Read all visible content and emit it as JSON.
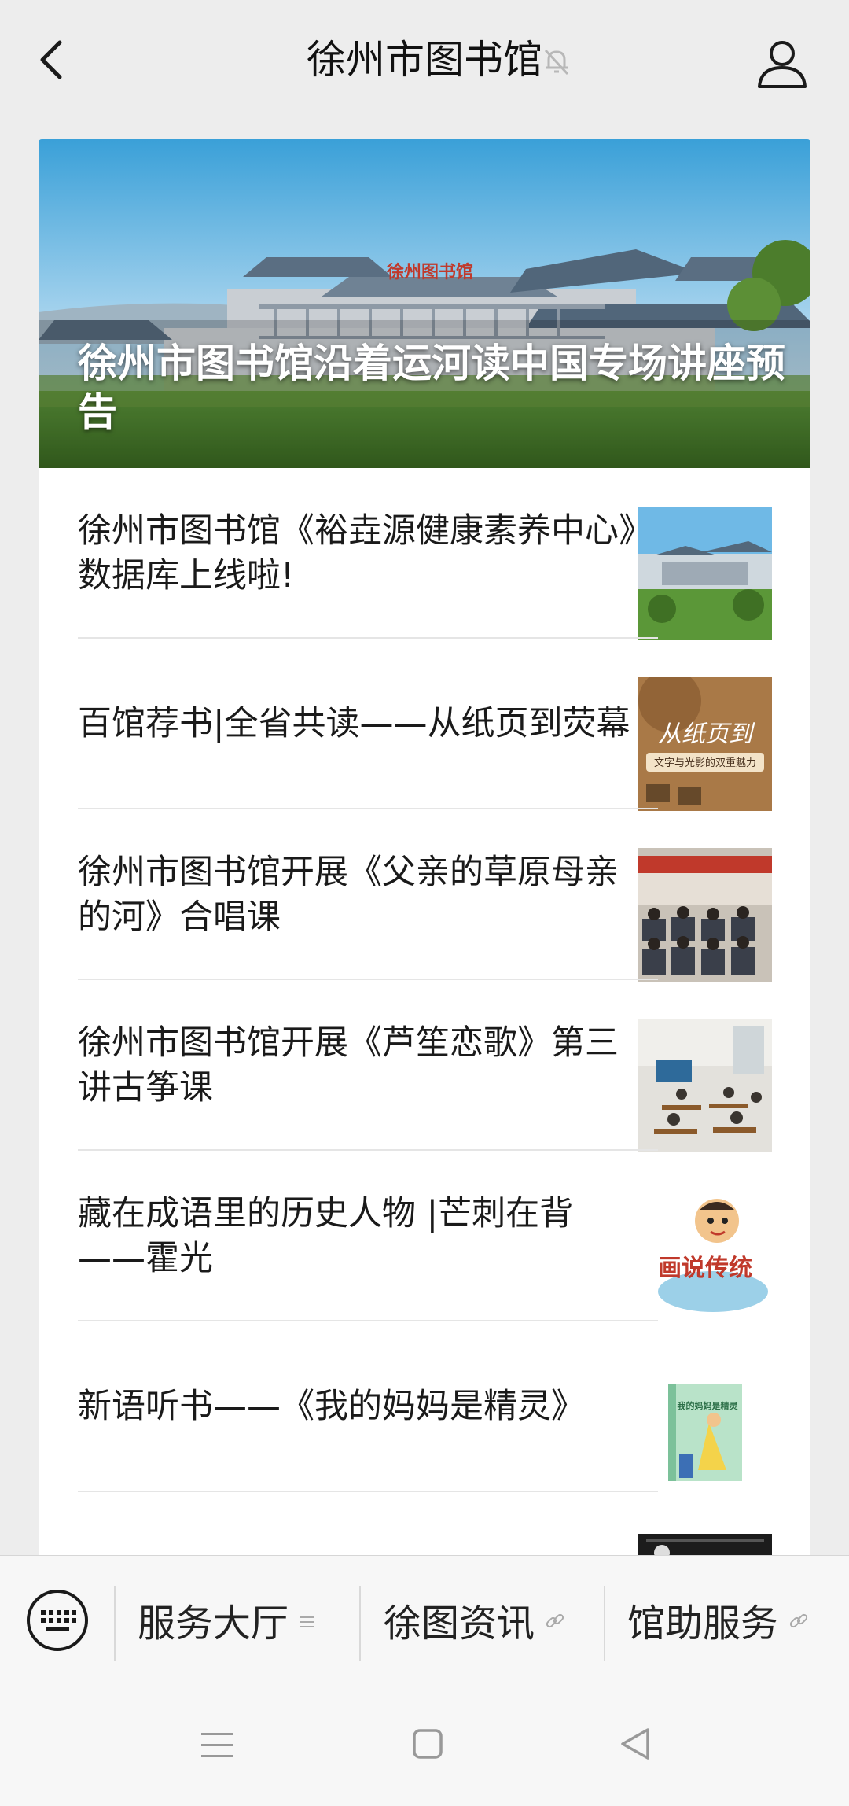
{
  "header": {
    "title": "徐州市图书馆",
    "back_icon": "chevron-left-icon",
    "mute_icon": "bell-off-icon",
    "profile_icon": "person-icon"
  },
  "hero": {
    "title": "徐州市图书馆沿着运河读中国专场讲座预告",
    "building_sign": "徐州图书馆"
  },
  "articles": [
    {
      "title": "徐州市图书馆《裕垚源健康素养中心》数据库上线啦!",
      "thumb": "library-building"
    },
    {
      "title": "百馆荐书|全省共读——从纸页到荧幕",
      "thumb": "paper-to-screen",
      "thumb_text_main": "从纸页到",
      "thumb_text_sub": "文字与光影的双重魅力"
    },
    {
      "title": "徐州市图书馆开展《父亲的草原母亲的河》合唱课",
      "thumb": "choir-class"
    },
    {
      "title": "徐州市图书馆开展《芦笙恋歌》第三讲古筝课",
      "thumb": "guzheng-class"
    },
    {
      "title": "藏在成语里的历史人物 |芒刺在背——霍光",
      "thumb": "cartoon-storytelling",
      "thumb_text": "画说传统"
    },
    {
      "title": "新语听书——《我的妈妈是精灵》",
      "thumb": "book-cover",
      "thumb_text": "我的妈妈是精灵"
    }
  ],
  "menu": {
    "keyboard_icon": "keyboard-icon",
    "items": [
      {
        "label": "服务大厅",
        "icon": "list-icon"
      },
      {
        "label": "徐图资讯",
        "icon": "link-icon"
      },
      {
        "label": "馆助服务",
        "icon": "link-icon"
      }
    ]
  },
  "system_nav": [
    "menu-icon",
    "home-icon",
    "back-icon"
  ],
  "colors": {
    "background": "#ededed",
    "card": "#ffffff",
    "text": "#1a1a1a",
    "divider": "#e5e5e5"
  }
}
